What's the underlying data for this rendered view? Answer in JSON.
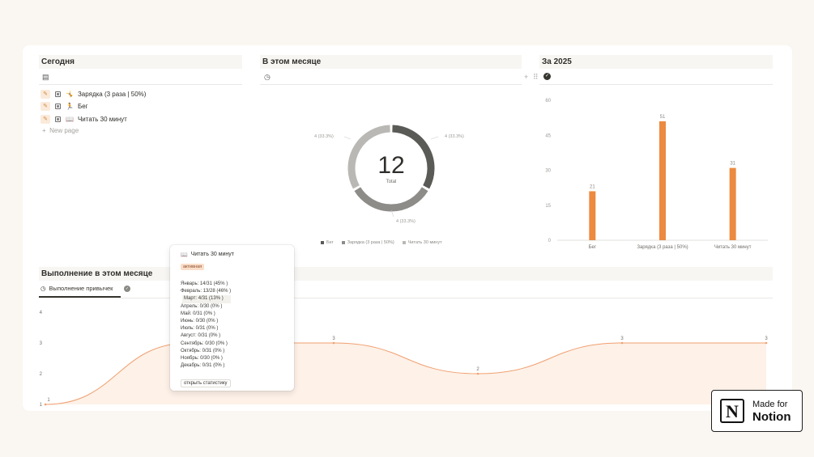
{
  "today": {
    "title": "Сегодня",
    "items": [
      {
        "emoji": "🤸",
        "label": "Зарядка (3 раза | 50%)"
      },
      {
        "emoji": "🏃",
        "label": "Бег"
      },
      {
        "emoji": "📖",
        "label": "Читать 30 минут"
      }
    ],
    "new_page": "New page"
  },
  "month": {
    "title": "В этом месяце",
    "donut_total": "12",
    "donut_total_label": "Total",
    "slice_labels": [
      "4 (33.3%)",
      "4 (33.3%)",
      "4 (33.3%)"
    ],
    "legend": [
      {
        "name": "Бег",
        "color": "#5a5a57"
      },
      {
        "name": "Зарядка (3 раза | 50%)",
        "color": "#8d8c89"
      },
      {
        "name": "Читать 30 минут",
        "color": "#b9b8b5"
      }
    ]
  },
  "year": {
    "title": "За 2025"
  },
  "progress": {
    "title": "Выполнение в этом месяце",
    "tab_label": "Выполнение привычек"
  },
  "popup": {
    "emoji": "📖",
    "title": "Читать 30 минут",
    "badge": "активная",
    "months": [
      "Январь: 14/31 (45% )",
      "Февраль: 13/28 (46% )",
      "Март: 4/31 (13% )",
      "Апрель: 0/30 (0% )",
      "Май: 0/31 (0% )",
      "Июнь: 0/30 (0% )",
      "Июль: 0/31 (0% )",
      "Август: 0/31 (0% )",
      "Сентябрь: 0/30 (0% )",
      "Октябрь: 0/31 (0% )",
      "Ноябрь: 0/30 (0% )",
      "Декабрь: 0/31 (0% )"
    ],
    "button": "открыть статистику"
  },
  "badge": {
    "line1": "Made for",
    "line2": "Notion",
    "logo": "N"
  },
  "colors": {
    "accent": "#ec8a3f",
    "line": "#f0a070"
  },
  "chart_data": [
    {
      "type": "pie",
      "categories": [
        "Бег",
        "Зарядка (3 раза | 50%)",
        "Читать 30 минут"
      ],
      "values": [
        4,
        4,
        4
      ],
      "total": 12
    },
    {
      "type": "bar",
      "categories": [
        "Бег",
        "Зарядка (3 раза | 50%)",
        "Читать 30 минут"
      ],
      "values": [
        21,
        51,
        31
      ],
      "yticks": [
        "0",
        "15",
        "30",
        "45",
        "60"
      ],
      "ylim": [
        0,
        60
      ],
      "grid": false
    },
    {
      "type": "area",
      "x": [
        1,
        2,
        3,
        4,
        5,
        6
      ],
      "values": [
        1,
        3,
        3,
        2,
        3,
        3
      ],
      "value_labels": [
        "1",
        "3",
        "3",
        "2",
        "3",
        "3"
      ],
      "yticks": [
        "1",
        "2",
        "3",
        "4"
      ],
      "ylim": [
        1,
        4
      ]
    }
  ]
}
